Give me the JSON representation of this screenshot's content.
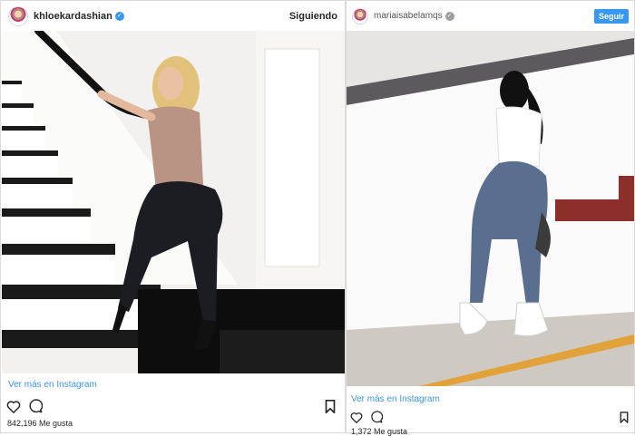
{
  "left_post": {
    "username": "khloekardashian",
    "verified": true,
    "follow_status": "Siguiendo",
    "more_link": "Ver más en Instagram",
    "likes": "842,196 Me gusta",
    "icons": [
      "heart-icon",
      "comment-icon",
      "bookmark-icon",
      "verified-badge-icon"
    ]
  },
  "right_post": {
    "username": "mariaisabelamqs",
    "verified": true,
    "follow_button": "Seguir",
    "more_link": "Ver más en Instagram",
    "likes": "1,372 Me gusta",
    "icons": [
      "heart-icon",
      "comment-icon",
      "bookmark-icon",
      "verified-badge-icon"
    ]
  },
  "colors": {
    "link_blue": "#3897f0",
    "border": "#dbdbdb",
    "text": "#262626"
  }
}
